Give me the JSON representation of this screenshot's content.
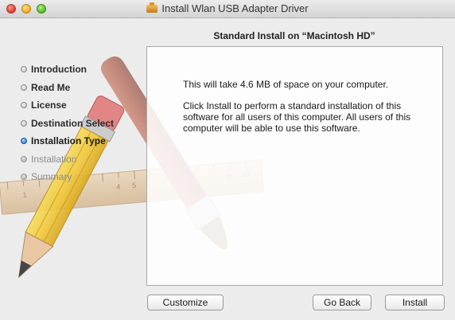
{
  "window": {
    "title": "Install Wlan USB Adapter Driver",
    "traffic_lights": [
      "close",
      "minimize",
      "zoom"
    ]
  },
  "pane_title": "Standard Install on “Macintosh HD”",
  "steps": [
    {
      "label": "Introduction",
      "state": "done"
    },
    {
      "label": "Read Me",
      "state": "done"
    },
    {
      "label": "License",
      "state": "done"
    },
    {
      "label": "Destination Select",
      "state": "done"
    },
    {
      "label": "Installation Type",
      "state": "current"
    },
    {
      "label": "Installation",
      "state": "future"
    },
    {
      "label": "Summary",
      "state": "future"
    }
  ],
  "content": {
    "line1": "This will take 4.6 MB of space on your computer.",
    "line2": "Click Install to perform a standard installation of this software for all users of this computer. All users of this computer will be able to use this software."
  },
  "buttons": {
    "customize": "Customize",
    "go_back": "Go Back",
    "install": "Install"
  },
  "ruler_numbers": [
    "1",
    "4",
    "5",
    "9",
    "10"
  ],
  "icons": {
    "title_icon": "package-icon",
    "step_bullet": "step-bullet-icon"
  },
  "colors": {
    "current_step": "#3b8fe6",
    "close": "#e0443a",
    "minimize": "#f2b12d",
    "zoom": "#5cc12f"
  }
}
